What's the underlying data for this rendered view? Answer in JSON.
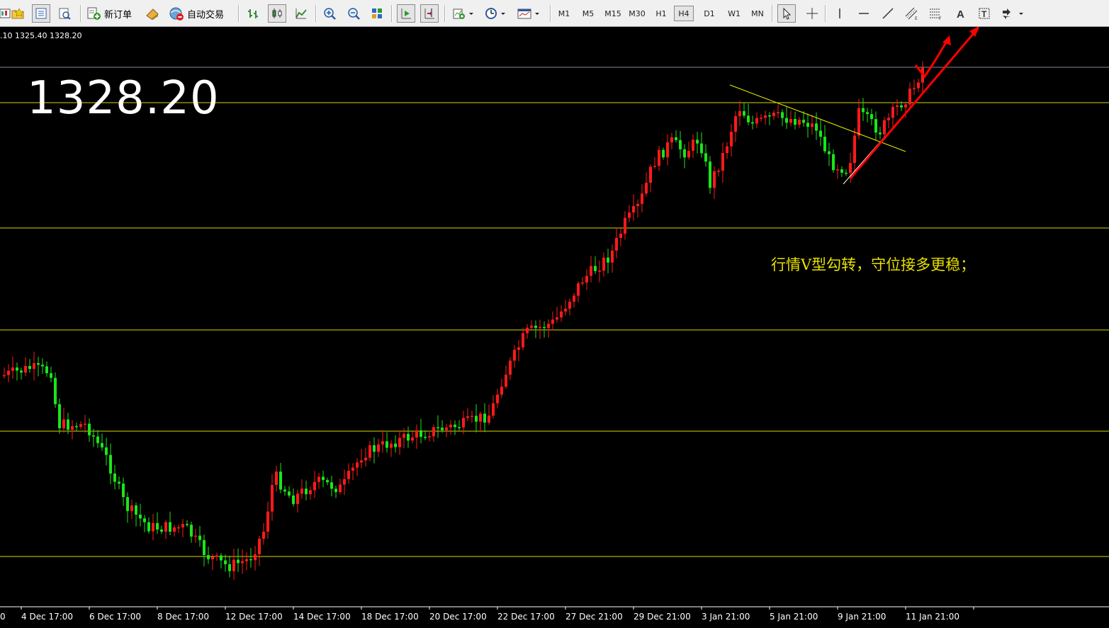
{
  "toolbar": {
    "new_order_label": "新订单",
    "auto_trading_label": "自动交易",
    "timeframes": [
      "M1",
      "M5",
      "M15",
      "M30",
      "H1",
      "H4",
      "D1",
      "W1",
      "MN"
    ],
    "active_timeframe": "H4",
    "icons": [
      "new-chart-icon",
      "open-profiles-icon",
      "market-watch-icon",
      "navigator-icon",
      "new-order-icon",
      "metaeditor-icon",
      "auto-trading-icon",
      "bar-chart-icon",
      "candlestick-icon",
      "line-chart-icon",
      "zoom-in-icon",
      "zoom-out-icon",
      "tile-windows-icon",
      "autoscroll-icon",
      "chart-shift-icon",
      "indicators-icon",
      "periods-icon",
      "templates-icon",
      "cursor-icon",
      "crosshair-icon",
      "vertical-line-icon",
      "horizontal-line-icon",
      "trendline-icon",
      "equidistant-channel-icon",
      "fibonacci-icon",
      "text-icon",
      "text-label-icon",
      "arrows-icon"
    ]
  },
  "chart": {
    "ohlc_text": ".10 1325.40 1328.20",
    "big_price": "1328.20",
    "annotation": "行情V型勾转，守位接多更稳；",
    "x_labels": [
      "0",
      "4 Dec 17:00",
      "6 Dec 17:00",
      "8 Dec 17:00",
      "12 Dec 17:00",
      "14 Dec 17:00",
      "18 Dec 17:00",
      "20 Dec 17:00",
      "22 Dec 17:00",
      "27 Dec 21:00",
      "29 Dec 21:00",
      "3 Jan 21:00",
      "5 Jan 21:00",
      "9 Jan 21:00",
      "11 Jan 21:00"
    ],
    "colors": {
      "background": "#000000",
      "bull": "#ff1a1a",
      "bear": "#19e619",
      "level_lines": "#d8d800",
      "annotation": "#e8e000",
      "drawing": "#ff0000"
    }
  }
}
